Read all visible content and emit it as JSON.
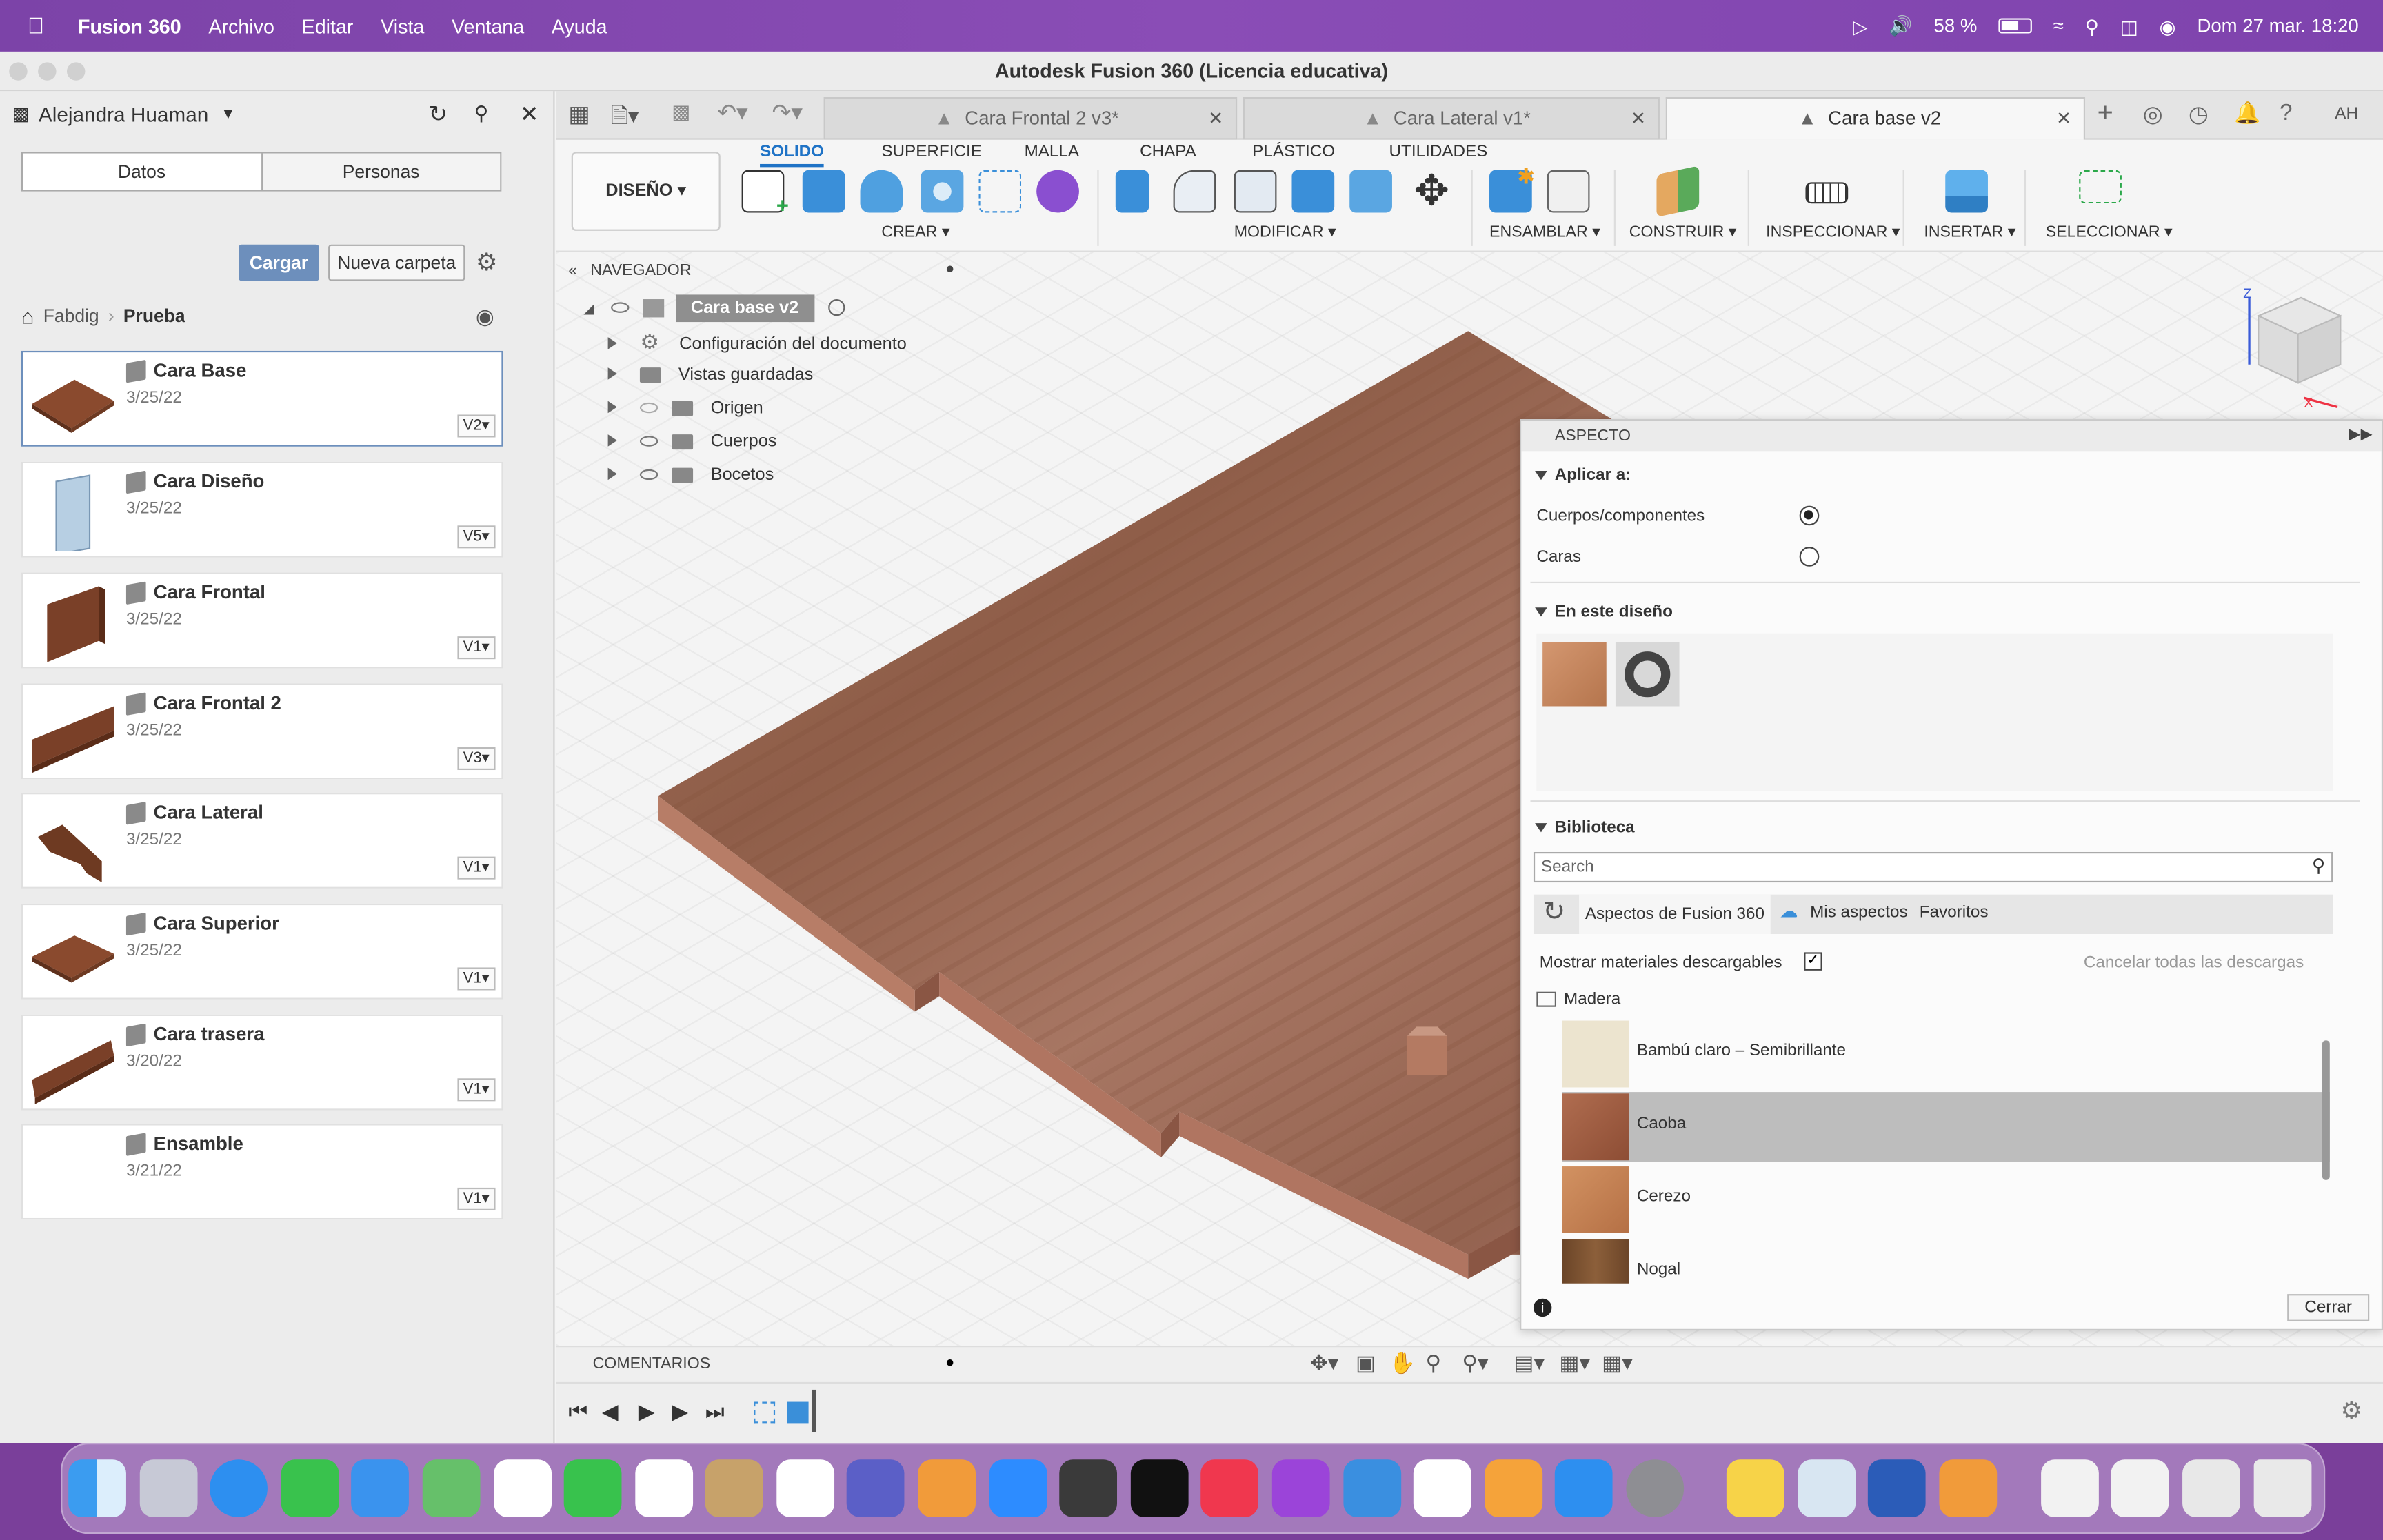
{
  "menubar": {
    "app": "Fusion 360",
    "items": [
      "Archivo",
      "Editar",
      "Vista",
      "Ventana",
      "Ayuda"
    ],
    "battery": "58 %",
    "datetime": "Dom 27 mar.  18:20"
  },
  "window": {
    "title": "Autodesk Fusion 360 (Licencia educativa)"
  },
  "data_panel": {
    "user": "Alejandra Huaman",
    "tabs": [
      "Datos",
      "Personas"
    ],
    "upload_button": "Cargar",
    "new_folder_button": "Nueva carpeta",
    "breadcrumb": [
      "Fabdig",
      "Prueba"
    ],
    "items": [
      {
        "name": "Cara Base",
        "date": "3/25/22",
        "version": "V2"
      },
      {
        "name": "Cara Diseño",
        "date": "3/25/22",
        "version": "V5"
      },
      {
        "name": "Cara Frontal",
        "date": "3/25/22",
        "version": "V1"
      },
      {
        "name": "Cara Frontal 2",
        "date": "3/25/22",
        "version": "V3"
      },
      {
        "name": "Cara Lateral",
        "date": "3/25/22",
        "version": "V1"
      },
      {
        "name": "Cara Superior",
        "date": "3/25/22",
        "version": "V1"
      },
      {
        "name": "Cara trasera",
        "date": "3/20/22",
        "version": "V1"
      },
      {
        "name": "Ensamble",
        "date": "3/21/22",
        "version": "V1"
      }
    ]
  },
  "doc_tabs": [
    {
      "label": "Cara Frontal 2 v3*",
      "active": false
    },
    {
      "label": "Cara Lateral v1*",
      "active": false
    },
    {
      "label": "Cara base v2",
      "active": true
    }
  ],
  "toolbar": {
    "workspace": "DISEÑO ▾",
    "tabs": [
      "SOLIDO",
      "SUPERFICIE",
      "MALLA",
      "CHAPA",
      "PLÁSTICO",
      "UTILIDADES"
    ],
    "groups": [
      "CREAR ▾",
      "MODIFICAR ▾",
      "ENSAMBLAR ▾",
      "CONSTRUIR ▾",
      "INSPECCIONAR ▾",
      "INSERTAR ▾",
      "SELECCIONAR ▾"
    ]
  },
  "navigator": {
    "title": "NAVEGADOR",
    "root": "Cara base v2",
    "rows": [
      "Configuración del documento",
      "Vistas guardadas",
      "Origen",
      "Cuerpos",
      "Bocetos"
    ]
  },
  "appearance": {
    "title": "ASPECTO",
    "apply_to_label": "Aplicar a:",
    "option_bodies": "Cuerpos/componentes",
    "option_faces": "Caras",
    "in_design_label": "En este diseño",
    "library_label": "Biblioteca",
    "search_placeholder": "Search",
    "lib_tabs": [
      "Aspectos de Fusion 360",
      "Mis aspectos",
      "Favoritos"
    ],
    "show_downloadable": "Mostrar materiales descargables",
    "cancel_downloads": "Cancelar todas las descargas",
    "folder": "Madera",
    "materials": [
      {
        "name": "Bambú claro – Semibrillante",
        "color": "#ece4cf",
        "selected": false
      },
      {
        "name": "Caoba",
        "color": "#a4664a",
        "selected": true
      },
      {
        "name": "Cerezo",
        "color": "#c58355",
        "selected": false
      },
      {
        "name": "Nogal",
        "color": "#7a5231",
        "selected": false
      }
    ],
    "close_button": "Cerrar"
  },
  "comments": {
    "label": "COMENTARIOS"
  },
  "colors": {
    "accent": "#1f73c6",
    "menubar": "#7c43a8",
    "wood": "#9e6a55"
  }
}
